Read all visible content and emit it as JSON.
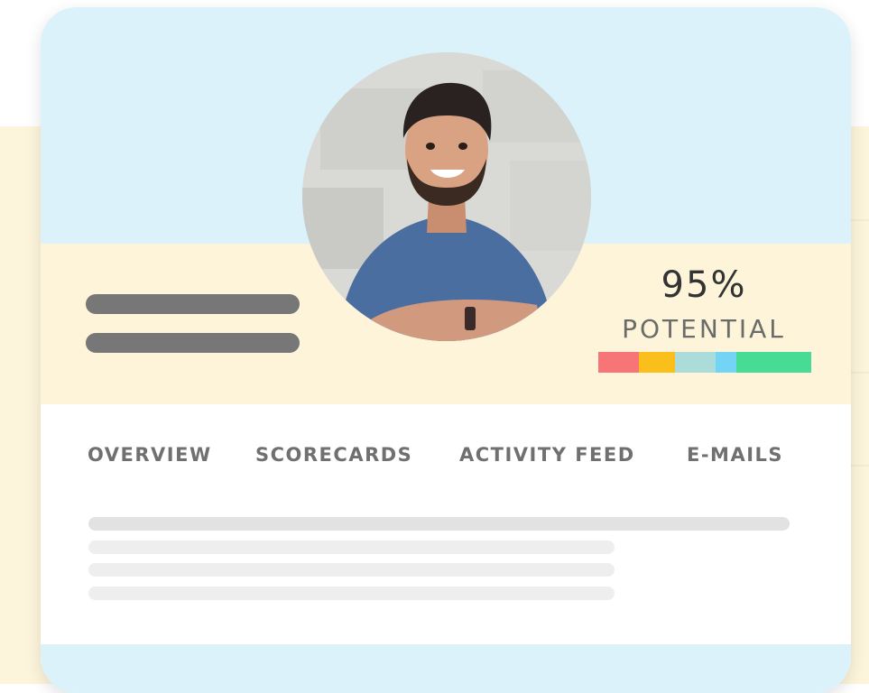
{
  "profile": {
    "avatar_alt": "",
    "potential": {
      "value_text": "95%",
      "label": "POTENTIAL",
      "segments": [
        {
          "color": "#f77577",
          "fraction": 0.19
        },
        {
          "color": "#fbbf1c",
          "fraction": 0.17
        },
        {
          "color": "#acdcd9",
          "fraction": 0.19
        },
        {
          "color": "#74d4f5",
          "fraction": 0.1
        },
        {
          "color": "#48db96",
          "fraction": 0.35
        }
      ]
    }
  },
  "tabs": [
    {
      "label": "OVERVIEW"
    },
    {
      "label": "SCORECARDS"
    },
    {
      "label": "ACTIVITY FEED"
    },
    {
      "label": "E-MAILS"
    }
  ],
  "colors": {
    "sky": "#dbf2fb",
    "cream": "#fdf4d9",
    "placeholder_dark": "#777777",
    "placeholder_light": "#e8e8e8"
  }
}
